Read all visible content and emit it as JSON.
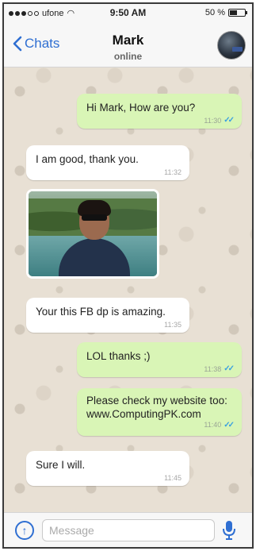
{
  "status": {
    "carrier": "ufone",
    "time": "9:50 AM",
    "battery_text": "50 %",
    "battery_level": 0.5
  },
  "nav": {
    "back_label": "Chats",
    "title": "Mark",
    "subtitle": "online"
  },
  "messages": [
    {
      "dir": "out",
      "text": "Hi Mark, How are you?",
      "time": "11:30",
      "read": true
    },
    {
      "dir": "in",
      "text": "I am good, thank you.",
      "time": "11:32"
    },
    {
      "dir": "in",
      "type": "photo"
    },
    {
      "dir": "in",
      "text": "Your this FB dp is amazing.",
      "time": "11:35"
    },
    {
      "dir": "out",
      "text": "LOL thanks ;)",
      "time": "11:38",
      "read": true
    },
    {
      "dir": "out",
      "text": "Please check my website too: www.ComputingPK.com",
      "time": "11:40",
      "read": true
    },
    {
      "dir": "in",
      "text": "Sure I will.",
      "time": "11:45"
    }
  ],
  "composer": {
    "placeholder": "Message"
  },
  "colors": {
    "accent": "#2f6fd2",
    "outgoing_bubble": "#d9f5b6",
    "incoming_bubble": "#ffffff",
    "read_ticks": "#3aa1e0"
  }
}
